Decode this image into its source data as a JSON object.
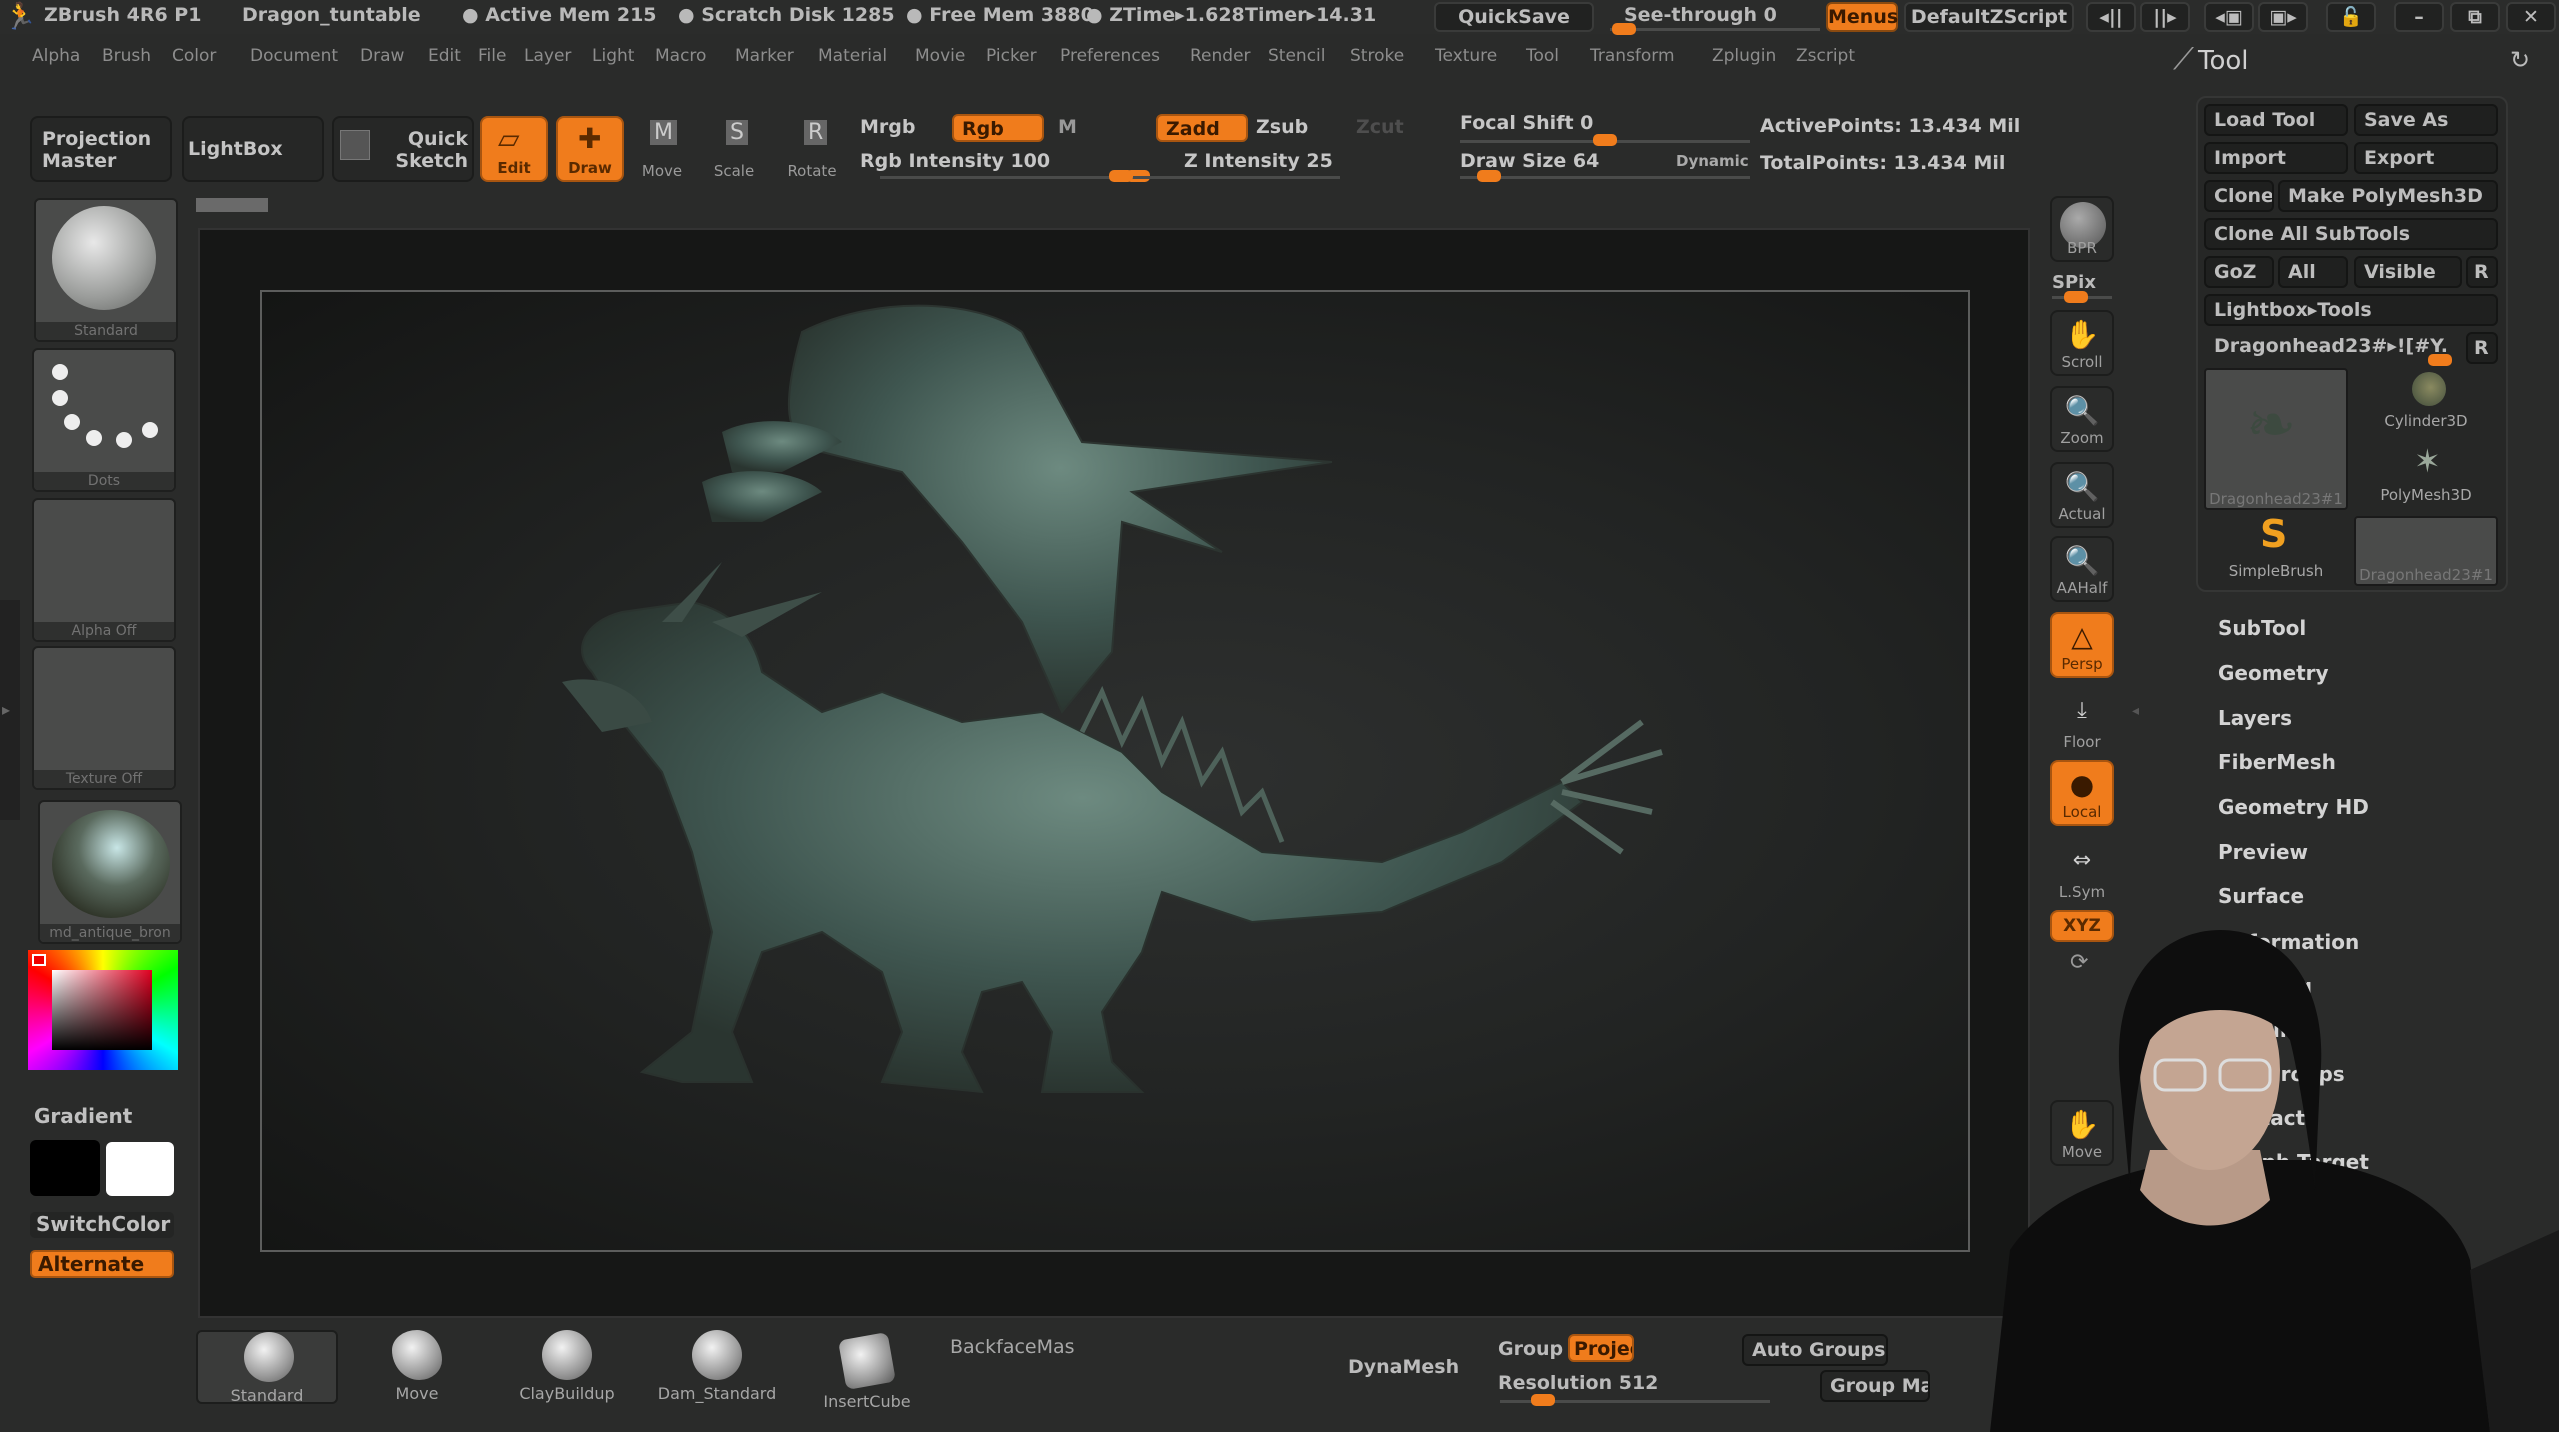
{
  "titlebar": {
    "app": "ZBrush 4R6 P1",
    "document": "Dragon_tuntable",
    "active_mem": "● Active Mem 215",
    "scratch_disk": "● Scratch Disk 1285",
    "free_mem": "● Free Mem 3880",
    "ztime": "● ZTime▸1.628",
    "timer": "Timer▸14.31",
    "quicksave": "QuickSave",
    "seethrough": "See-through  0",
    "menus": "Menus",
    "defaultzscript": "DefaultZScript"
  },
  "menubar": [
    "Alpha",
    "Brush",
    "Color",
    "Document",
    "Draw",
    "Edit",
    "File",
    "Layer",
    "Light",
    "Macro",
    "Marker",
    "Material",
    "Movie",
    "Picker",
    "Preferences",
    "Render",
    "Stencil",
    "Stroke",
    "Texture",
    "Tool",
    "Transform",
    "Zplugin",
    "Zscript"
  ],
  "tool_panel": {
    "title": "Tool",
    "buttons": {
      "load_tool": "Load Tool",
      "save_as": "Save As",
      "import": "Import",
      "export": "Export",
      "clone": "Clone",
      "make_polymesh": "Make PolyMesh3D",
      "clone_all": "Clone All SubTools",
      "goz": "GoZ",
      "all": "All",
      "visible": "Visible",
      "r": "R",
      "lightbox_tools": "Lightbox▸Tools",
      "current_tool": "Dragonhead23#▸![#Y."
    },
    "thumbs": [
      "Dragonhead23#1",
      "Cylinder3D",
      "PolyMesh3D",
      "SimpleBrush",
      "Dragonhead23#1"
    ],
    "subpalettes": [
      "SubTool",
      "Geometry",
      "Layers",
      "FiberMesh",
      "Geometry HD",
      "Preview",
      "Surface",
      "Deformation",
      "Masking",
      "Visibility",
      "Polygroups",
      "Contact",
      "Morph Target"
    ]
  },
  "top_shelf": {
    "projection_master": [
      "Projection",
      "Master"
    ],
    "lightbox": "LightBox",
    "quick_sketch": [
      "Quick",
      "Sketch"
    ],
    "edit": "Edit",
    "draw": "Draw",
    "move": "Move",
    "scale": "Scale",
    "rotate": "Rotate",
    "mrgb": "Mrgb",
    "rgb": "Rgb",
    "m": "M",
    "zadd": "Zadd",
    "zsub": "Zsub",
    "zcut": "Zcut",
    "rgb_intensity_label": "Rgb Intensity",
    "rgb_intensity": 100,
    "z_intensity_label": "Z Intensity",
    "z_intensity": 25,
    "focal_shift_label": "Focal Shift",
    "focal_shift": 0,
    "draw_size_label": "Draw Size",
    "draw_size": 64,
    "dynamic": "Dynamic",
    "active_points": "ActivePoints: 13.434  Mil",
    "total_points": "TotalPoints: 13.434  Mil"
  },
  "left_shelf": {
    "brush": "Standard",
    "stroke": "Dots",
    "alpha": "Alpha  Off",
    "texture": "Texture  Off",
    "material": "md_antique_bron",
    "gradient": "Gradient",
    "switchcolor": "SwitchColor",
    "alternate": "Alternate",
    "main_color": "#000000",
    "secondary_color": "#ffffff"
  },
  "right_shelf": {
    "bpr": "BPR",
    "spix": "SPix",
    "scroll": "Scroll",
    "zoom": "Zoom",
    "actual": "Actual",
    "aahalf": "AAHalf",
    "persp": "Persp",
    "floor": "Floor",
    "local": "Local",
    "lsym": "L.Sym",
    "xyz": "XYZ",
    "move": "Move"
  },
  "bottom_shelf": {
    "brushes": [
      "Standard",
      "Move",
      "ClayBuildup",
      "Dam_Standard",
      "InsertCube"
    ],
    "backface": "BackfaceMas",
    "dynamesh": "DynaMesh",
    "group": "Group",
    "project": "Projec",
    "resolution_label": "Resolution",
    "resolution": 512,
    "auto_groups": "Auto Groups",
    "group_masks": "Group Ma"
  },
  "colors": {
    "accent": "#f07c1c",
    "panel": "#2a2b2a",
    "text": "#c9c9c9"
  }
}
